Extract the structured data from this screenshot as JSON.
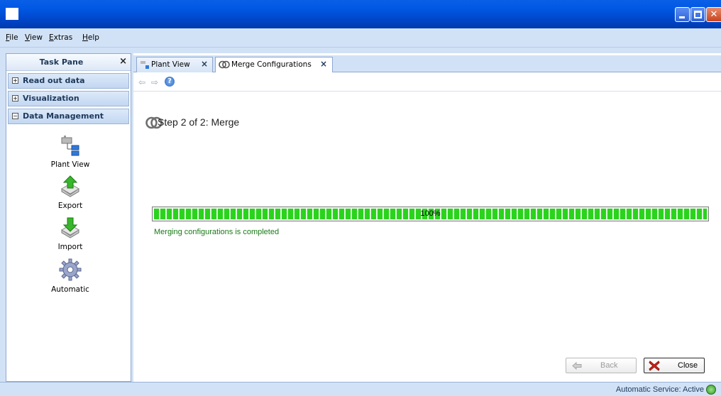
{
  "window": {
    "title": ""
  },
  "menu": [
    {
      "label": "File",
      "mnemonic": "F",
      "rest": "ile"
    },
    {
      "label": "View",
      "mnemonic": "V",
      "rest": "iew"
    },
    {
      "label": "Extras",
      "mnemonic": "E",
      "rest": "xtras"
    },
    {
      "label": "Help",
      "mnemonic": "H",
      "rest": "elp"
    }
  ],
  "task_pane": {
    "title": "Task Pane",
    "close": "×",
    "sections": [
      {
        "label": "Read out data",
        "state": "+"
      },
      {
        "label": "Visualization",
        "state": "+"
      },
      {
        "label": "Data Management",
        "state": "−"
      }
    ],
    "tools": [
      {
        "label": "Plant View",
        "icon": "plant-view-icon"
      },
      {
        "label": "Export",
        "icon": "export-icon"
      },
      {
        "label": "Import",
        "icon": "import-icon"
      },
      {
        "label": "Automatic",
        "icon": "gear-icon"
      }
    ]
  },
  "tabs": [
    {
      "label": "Plant View",
      "close": "×",
      "icon": "plant-view-icon"
    },
    {
      "label": "Merge Configurations",
      "close": "×",
      "icon": "merge-icon"
    }
  ],
  "wizard": {
    "step_title": "Step 2 of 2: Merge",
    "progress": 1.0,
    "progress_text": "100%",
    "status_message": "Merging configurations is completed",
    "back_label": "Back",
    "close_label": "Close"
  },
  "status_bar": {
    "text": "Automatic Service: Active"
  },
  "colors": {
    "titlebar": "#0058e4",
    "frame": "#d2e2f6",
    "progress": "#2ad31c",
    "status_green": "#197a17"
  }
}
